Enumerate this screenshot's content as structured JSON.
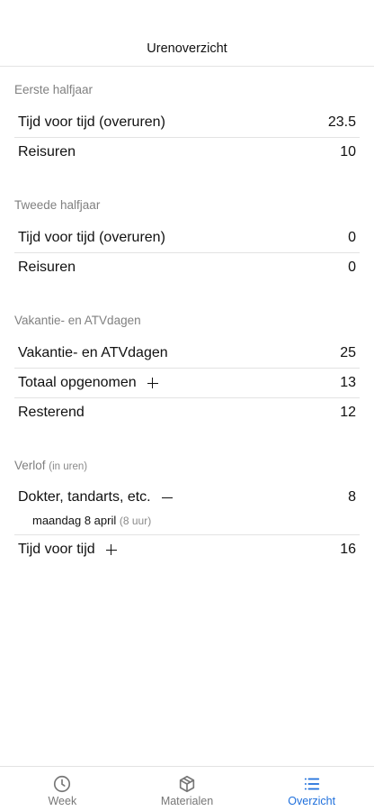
{
  "header": {
    "title": "Urenoverzicht"
  },
  "sections": {
    "first_half": {
      "title": "Eerste halfjaar",
      "rows": [
        {
          "label": "Tijd voor tijd (overuren)",
          "value": "23.5"
        },
        {
          "label": "Reisuren",
          "value": "10"
        }
      ]
    },
    "second_half": {
      "title": "Tweede halfjaar",
      "rows": [
        {
          "label": "Tijd voor tijd (overuren)",
          "value": "0"
        },
        {
          "label": "Reisuren",
          "value": "0"
        }
      ]
    },
    "vacation": {
      "title": "Vakantie- en ATVdagen",
      "rows": [
        {
          "label": "Vakantie- en ATVdagen",
          "value": "25"
        },
        {
          "label": "Totaal opgenomen",
          "value": "13",
          "icon": "plus-icon"
        },
        {
          "label": "Resterend",
          "value": "12"
        }
      ]
    },
    "leave": {
      "title": "Verlof",
      "subtitle": "(in uren)",
      "rows": [
        {
          "label": "Dokter, tandarts, etc.",
          "value": "8",
          "icon": "minus-icon",
          "detail_date": "maandag 8 april",
          "detail_hours": "(8 uur)"
        },
        {
          "label": "Tijd voor tijd",
          "value": "16",
          "icon": "plus-icon"
        }
      ]
    }
  },
  "tabbar": {
    "accent_color": "#1e6fdc",
    "tabs": [
      {
        "label": "Week",
        "icon": "clock-icon",
        "active": false
      },
      {
        "label": "Materialen",
        "icon": "box-icon",
        "active": false
      },
      {
        "label": "Overzicht",
        "icon": "list-icon",
        "active": true
      }
    ]
  }
}
